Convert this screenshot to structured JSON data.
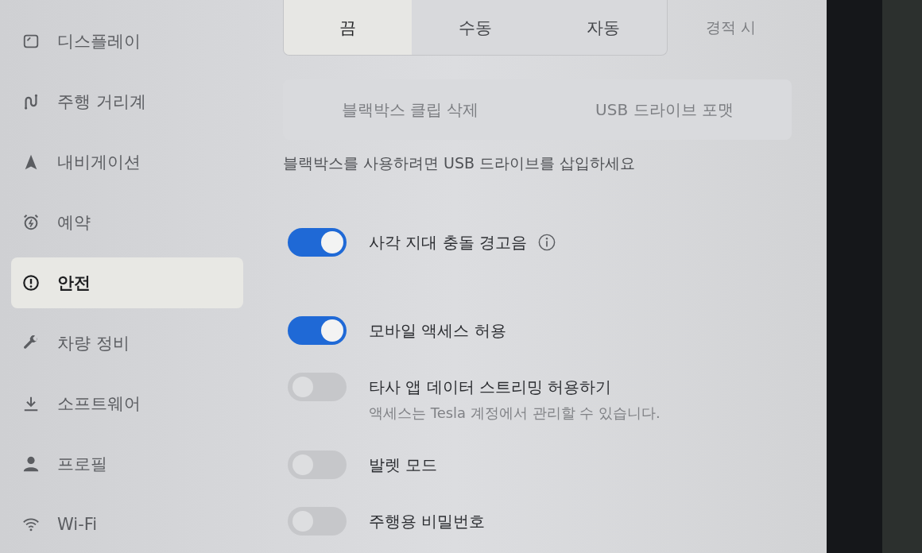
{
  "sidebar": {
    "items": [
      {
        "label": "디스플레이",
        "selected": false
      },
      {
        "label": "주행 거리계",
        "selected": false
      },
      {
        "label": "내비게이션",
        "selected": false
      },
      {
        "label": "예약",
        "selected": false
      },
      {
        "label": "안전",
        "selected": true
      },
      {
        "label": "차량 정비",
        "selected": false
      },
      {
        "label": "소프트웨어",
        "selected": false
      },
      {
        "label": "프로필",
        "selected": false
      },
      {
        "label": "Wi-Fi",
        "selected": false
      }
    ]
  },
  "mode_selector": {
    "options": [
      {
        "label": "끔",
        "selected": true
      },
      {
        "label": "수동",
        "selected": false
      },
      {
        "label": "자동",
        "selected": false
      }
    ]
  },
  "honk_option": {
    "label": "경적 시",
    "disabled": true
  },
  "clip_actions": [
    {
      "label": "블랙박스 클립 삭제",
      "disabled": true
    },
    {
      "label": "USB 드라이브 포맷",
      "disabled": true
    }
  ],
  "usb_notice": "블랙박스를 사용하려면 USB 드라이브를 삽입하세요",
  "settings": [
    {
      "label": "사각 지대 충돌 경고음",
      "on": true,
      "info": true
    },
    {
      "label": "모바일 액세스 허용",
      "on": true
    },
    {
      "label": "타사 앱 데이터 스트리밍 허용하기",
      "on": false,
      "note": "액세스는 Tesla 계정에서 관리할 수 있습니다."
    },
    {
      "label": "발렛 모드",
      "on": false
    },
    {
      "label": "주행용 비밀번호",
      "on": false
    }
  ]
}
